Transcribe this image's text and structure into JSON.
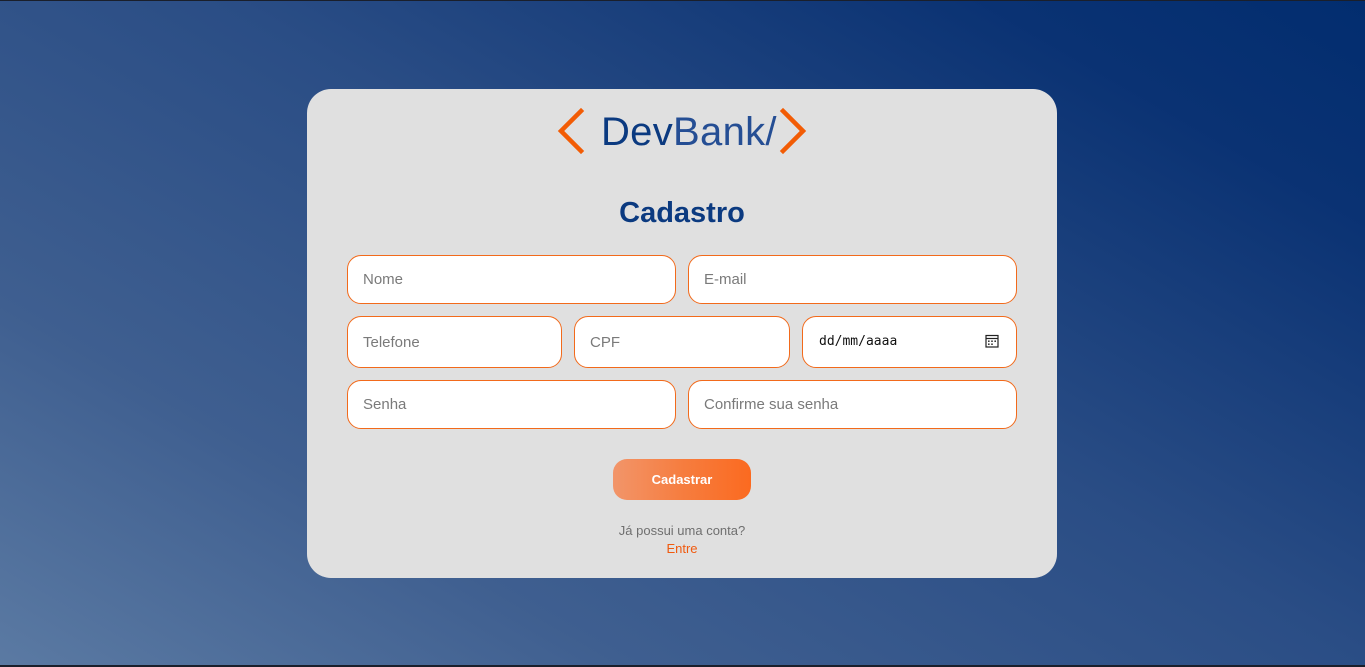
{
  "brand": {
    "name_part1": "Dev",
    "name_part2": "Bank/",
    "accent_color": "#f25c05",
    "primary_color": "#0b3a80"
  },
  "form": {
    "title": "Cadastro",
    "fields": {
      "nome_placeholder": "Nome",
      "email_placeholder": "E-mail",
      "telefone_placeholder": "Telefone",
      "cpf_placeholder": "CPF",
      "date_placeholder": "dd/mm/aaaa",
      "senha_placeholder": "Senha",
      "confirm_placeholder": "Confirme sua senha"
    },
    "submit_label": "Cadastrar",
    "has_account_text": "Já possui uma conta?",
    "login_link_label": "Entre"
  },
  "icons": {
    "logo_left": "chevron-left-icon",
    "logo_right": "chevron-right-icon",
    "date": "calendar-icon"
  }
}
